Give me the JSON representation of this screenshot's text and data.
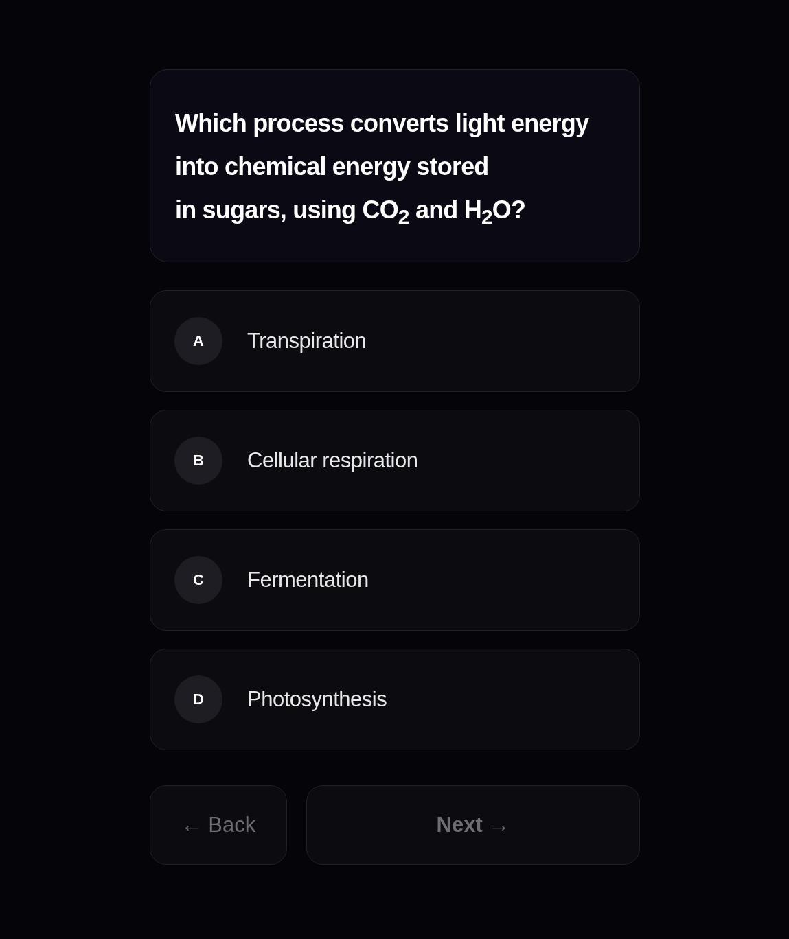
{
  "question": "Which process converts light energy\ninto chemical energy stored\nin sugars, using CO$_{2}$ and H$_{2}$O?",
  "options": [
    {
      "letter": "A",
      "label": "Transpiration"
    },
    {
      "letter": "B",
      "label": "Cellular respiration"
    },
    {
      "letter": "C",
      "label": "Fermentation"
    },
    {
      "letter": "D",
      "label": "Photosynthesis"
    }
  ],
  "back_button": "← Back",
  "next_button": "Next →"
}
